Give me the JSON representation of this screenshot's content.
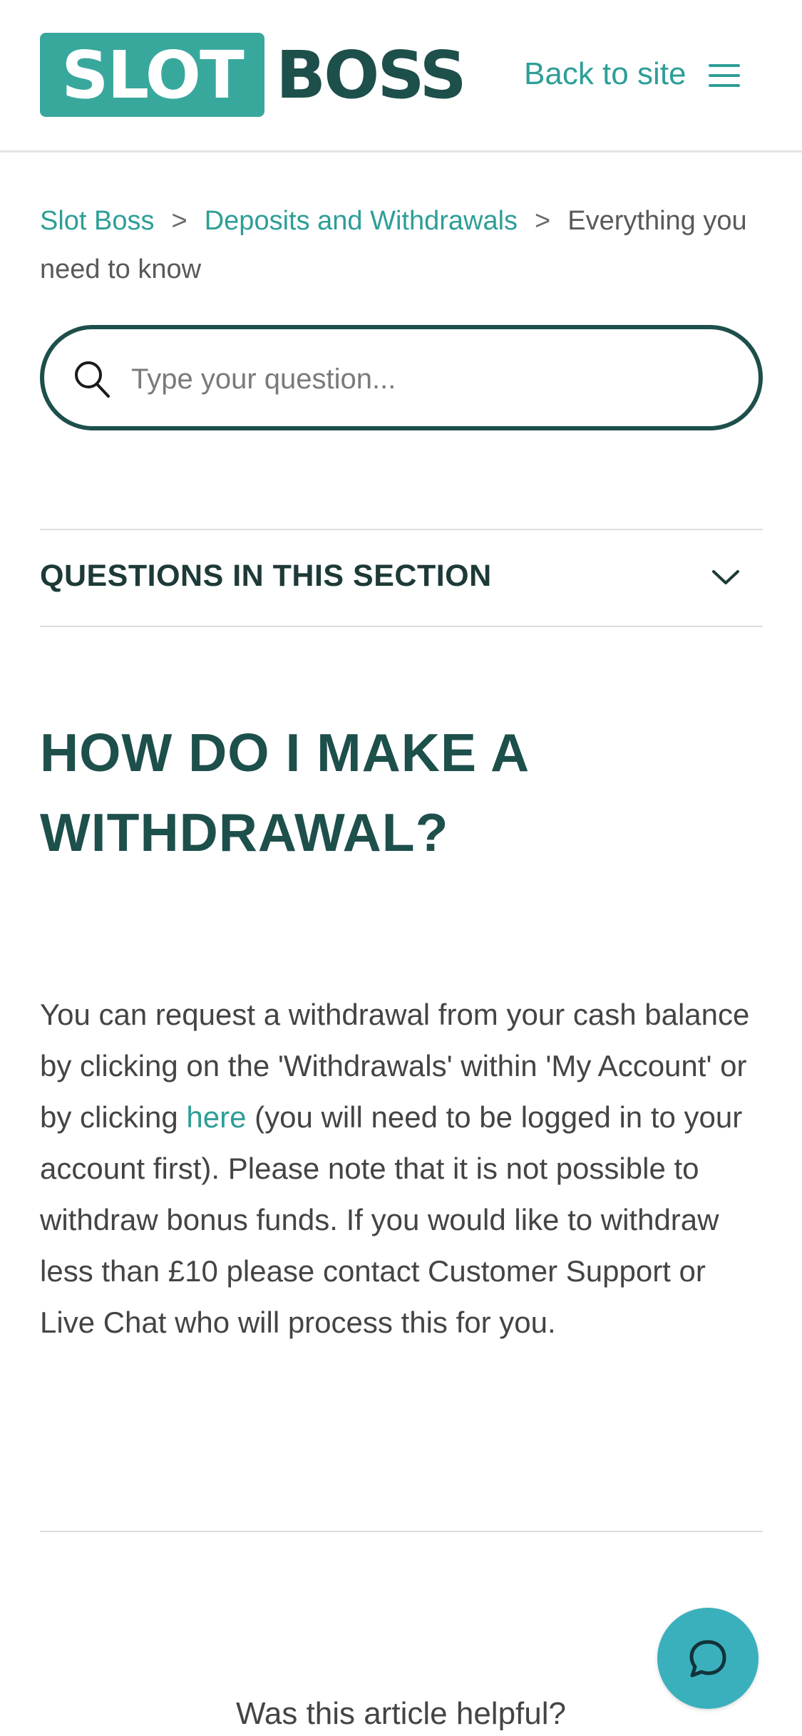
{
  "header": {
    "logo_part1": "SLOT",
    "logo_part2": "BOSS",
    "back_link": "Back to site",
    "menu_icon": "hamburger-menu-icon"
  },
  "breadcrumb": {
    "items": [
      "Slot Boss",
      "Deposits and Withdrawals",
      "Everything you need to know"
    ],
    "separator": ">"
  },
  "search": {
    "placeholder": "Type your question...",
    "value": "",
    "icon": "search-icon"
  },
  "section": {
    "title": "QUESTIONS IN THIS SECTION",
    "icon": "chevron-down-icon"
  },
  "article": {
    "title": "HOW DO I MAKE A WITHDRAWAL?",
    "body_part1": "You can request a withdrawal from your cash balance by clicking on the 'Withdrawals' within 'My Account' or by clicking ",
    "link_text": "here",
    "body_part2": " (you will need to be logged in to your account first). Please note that it is not possible to withdraw bonus funds. If you would like to withdraw less than £10 please contact Customer Support or Live Chat who will process this for you."
  },
  "feedback": {
    "question": "Was this article helpful?"
  },
  "chat": {
    "icon": "chat-bubble-icon"
  },
  "colors": {
    "brand_teal": "#38a89d",
    "brand_dark": "#1d4f4b",
    "link": "#2e9e97",
    "chat_button": "#3ab0bd"
  }
}
